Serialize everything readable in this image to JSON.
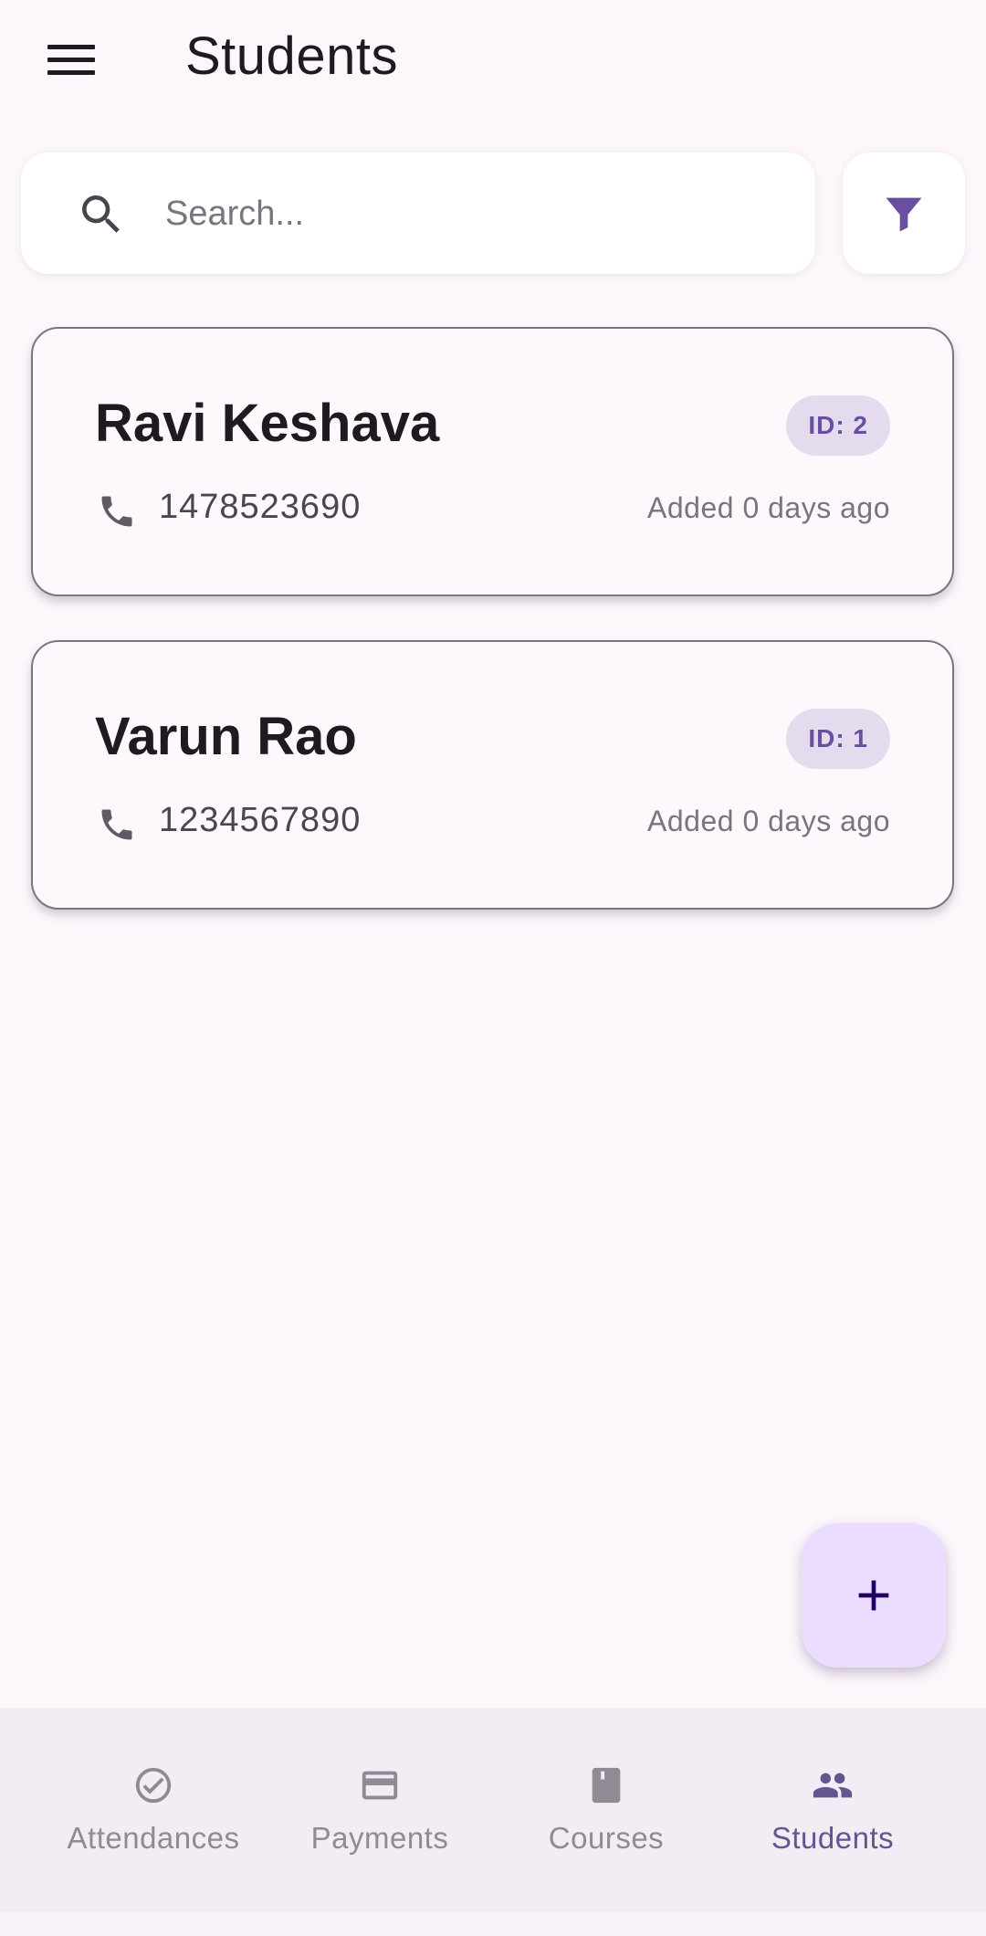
{
  "header": {
    "title": "Students",
    "menu_icon": "menu-icon"
  },
  "search": {
    "placeholder": "Search...",
    "value": "",
    "icon": "search-icon",
    "filter_icon": "filter-icon"
  },
  "students": [
    {
      "name": "Ravi Keshava",
      "id_label": "ID: 2",
      "phone": "1478523690",
      "added": "Added 0 days ago"
    },
    {
      "name": "Varun Rao",
      "id_label": "ID: 1",
      "phone": "1234567890",
      "added": "Added 0 days ago"
    }
  ],
  "fab": {
    "icon": "add-icon"
  },
  "bottom_nav": {
    "items": [
      {
        "label": "Attendances",
        "icon": "check-circle-icon",
        "active": false
      },
      {
        "label": "Payments",
        "icon": "credit-card-icon",
        "active": false
      },
      {
        "label": "Courses",
        "icon": "book-icon",
        "active": false
      },
      {
        "label": "Students",
        "icon": "people-icon",
        "active": true
      }
    ]
  },
  "colors": {
    "background": "#fdf7fc",
    "accent": "#65558f",
    "fab": "#eaddff",
    "badge": "#e4dbee",
    "nav_bg": "#f2ecf4"
  }
}
